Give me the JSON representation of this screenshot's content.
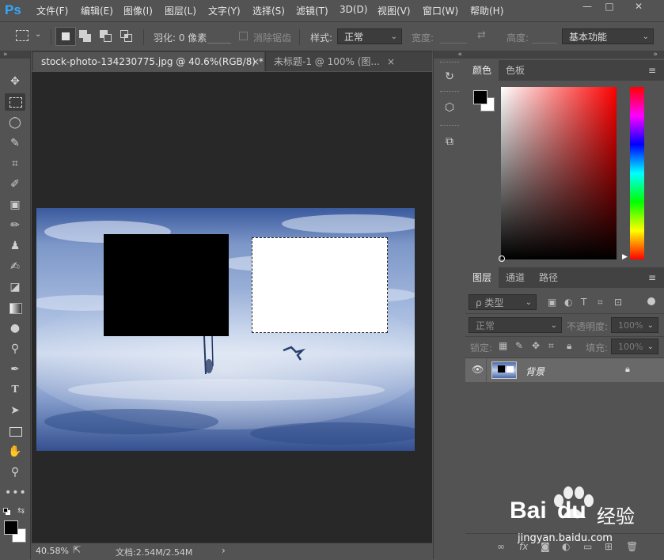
{
  "app": {
    "logo": "Ps"
  },
  "menu": [
    "文件(F)",
    "编辑(E)",
    "图像(I)",
    "图层(L)",
    "文字(Y)",
    "选择(S)",
    "滤镜(T)",
    "3D(D)",
    "视图(V)",
    "窗口(W)",
    "帮助(H)"
  ],
  "window_controls": {
    "minimize": "—",
    "maximize": "□",
    "close": "✕"
  },
  "options": {
    "feather_label": "羽化: 0 像素",
    "antialias_label": "消除锯齿",
    "style_label": "样式:",
    "style_value": "正常",
    "width_label": "宽度:",
    "height_label": "高度:",
    "workspace": "基本功能"
  },
  "tabs": [
    {
      "label": "stock-photo-134230775.jpg @ 40.6%(RGB/8) *",
      "close": "×"
    },
    {
      "label": "未标题-1 @ 100% (图...",
      "close": "×"
    }
  ],
  "status": {
    "zoom": "40.58%",
    "doc": "文档:2.54M/2.54M",
    "arrow": "›"
  },
  "color_panel": {
    "tabs": [
      "颜色",
      "色板"
    ],
    "foreground": "#000000",
    "background": "#ffffff"
  },
  "layers_panel": {
    "tabs": [
      "图层",
      "通道",
      "路径"
    ],
    "filter_label": "ρ 类型",
    "blend_mode": "正常",
    "opacity_label": "不透明度:",
    "opacity_value": "100%",
    "lock_label": "锁定:",
    "fill_label": "填充:",
    "fill_value": "100%",
    "layers": [
      {
        "name": "背景",
        "visible": true,
        "locked": true
      }
    ]
  },
  "footer_icons": [
    "link-icon",
    "fx-icon",
    "mask-icon",
    "adjustment-icon",
    "folder-icon",
    "new-layer-icon",
    "trash-icon"
  ],
  "watermark": {
    "brand": "Bai",
    "brand2": "du",
    "cn": "经验",
    "url": "jingyan.baidu.com"
  },
  "colors": {
    "accent": "#31a8ff",
    "workspace_bg": "#282828",
    "panel_bg": "#535353"
  }
}
